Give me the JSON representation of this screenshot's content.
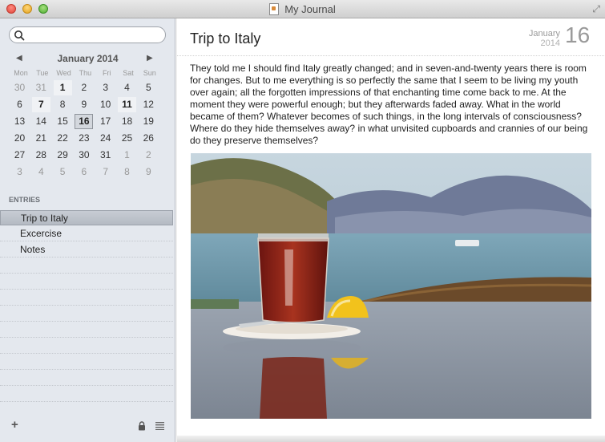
{
  "window": {
    "title": "My Journal"
  },
  "search": {
    "placeholder": ""
  },
  "calendar": {
    "month_label": "January 2014",
    "weekdays": [
      "Mon",
      "Tue",
      "Wed",
      "Thu",
      "Fri",
      "Sat",
      "Sun"
    ],
    "weeks": [
      [
        {
          "d": "30",
          "m": 1
        },
        {
          "d": "31",
          "m": 1
        },
        {
          "d": "1",
          "b": 1
        },
        {
          "d": "2"
        },
        {
          "d": "3"
        },
        {
          "d": "4"
        },
        {
          "d": "5"
        }
      ],
      [
        {
          "d": "6"
        },
        {
          "d": "7",
          "b": 1
        },
        {
          "d": "8"
        },
        {
          "d": "9"
        },
        {
          "d": "10"
        },
        {
          "d": "11",
          "b": 1
        },
        {
          "d": "12"
        }
      ],
      [
        {
          "d": "13"
        },
        {
          "d": "14"
        },
        {
          "d": "15"
        },
        {
          "d": "16",
          "s": 1
        },
        {
          "d": "17"
        },
        {
          "d": "18"
        },
        {
          "d": "19"
        }
      ],
      [
        {
          "d": "20"
        },
        {
          "d": "21"
        },
        {
          "d": "22"
        },
        {
          "d": "23"
        },
        {
          "d": "24"
        },
        {
          "d": "25"
        },
        {
          "d": "26"
        }
      ],
      [
        {
          "d": "27"
        },
        {
          "d": "28"
        },
        {
          "d": "29"
        },
        {
          "d": "30"
        },
        {
          "d": "31"
        },
        {
          "d": "1",
          "m": 1
        },
        {
          "d": "2",
          "m": 1
        }
      ],
      [
        {
          "d": "3",
          "m": 1
        },
        {
          "d": "4",
          "m": 1
        },
        {
          "d": "5",
          "m": 1
        },
        {
          "d": "6",
          "m": 1
        },
        {
          "d": "7",
          "m": 1
        },
        {
          "d": "8",
          "m": 1
        },
        {
          "d": "9",
          "m": 1
        }
      ]
    ]
  },
  "sidebar": {
    "entries_heading": "ENTRIES",
    "entries": [
      "Trip to Italy",
      "Excercise",
      "Notes"
    ],
    "selected_entry": "Trip to Italy",
    "empty_rows": 9
  },
  "entry": {
    "title": "Trip to Italy",
    "date_month": "January",
    "date_year": "2014",
    "date_day": "16",
    "body": "They told me I should find Italy greatly changed; and in seven-and-twenty years there is room for changes.  But to me everything is so perfectly the same that I seem to be living my youth over again; all the forgotten impressions of that enchanting time come back to me.  At the moment they were powerful enough; but they afterwards faded away.  What in the world became of them?  Whatever becomes of such things, in the long intervals of consciousness? Where do they hide themselves away? in what unvisited cupboards and crannies of our being do they preserve themselves?"
  },
  "icons": {
    "search": "search-icon",
    "prev": "chevron-left-icon",
    "next": "chevron-right-icon",
    "add": "plus-icon",
    "lock": "lock-icon",
    "menu": "list-icon",
    "fullscreen": "fullscreen-icon"
  }
}
